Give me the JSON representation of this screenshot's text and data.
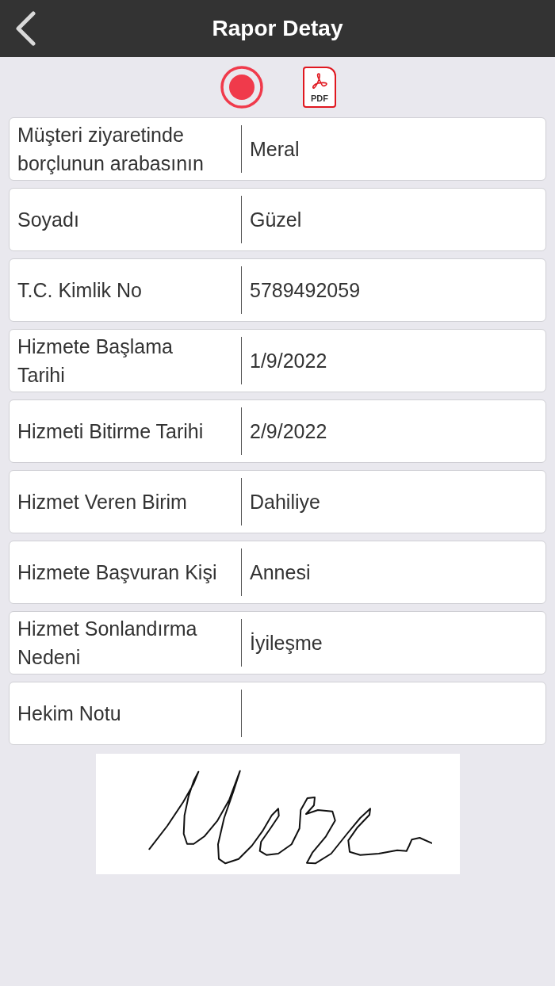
{
  "header": {
    "title": "Rapor Detay",
    "back_button": true
  },
  "actions": [
    {
      "kind": "record"
    },
    {
      "kind": "pdf",
      "label": "PDF"
    }
  ],
  "fields": [
    {
      "label": "Müşteri ziyaretinde borçlunun arabasının",
      "value": "Meral"
    },
    {
      "label": "Soyadı",
      "value": "Güzel"
    },
    {
      "label": "T.C. Kimlik No",
      "value": "5789492059"
    },
    {
      "label": "Hizmete Başlama Tarihi",
      "value": "1/9/2022"
    },
    {
      "label": "Hizmeti Bitirme Tarihi",
      "value": "2/9/2022"
    },
    {
      "label": "Hizmet Veren Birim",
      "value": "Dahiliye"
    },
    {
      "label": "Hizmete Başvuran Kişi",
      "value": "Annesi"
    },
    {
      "label": "Hizmet Sonlandırma Nedeni",
      "value": "İyileşme"
    },
    {
      "label": "Hekim Notu"
    }
  ],
  "signature": {
    "signed": true
  }
}
